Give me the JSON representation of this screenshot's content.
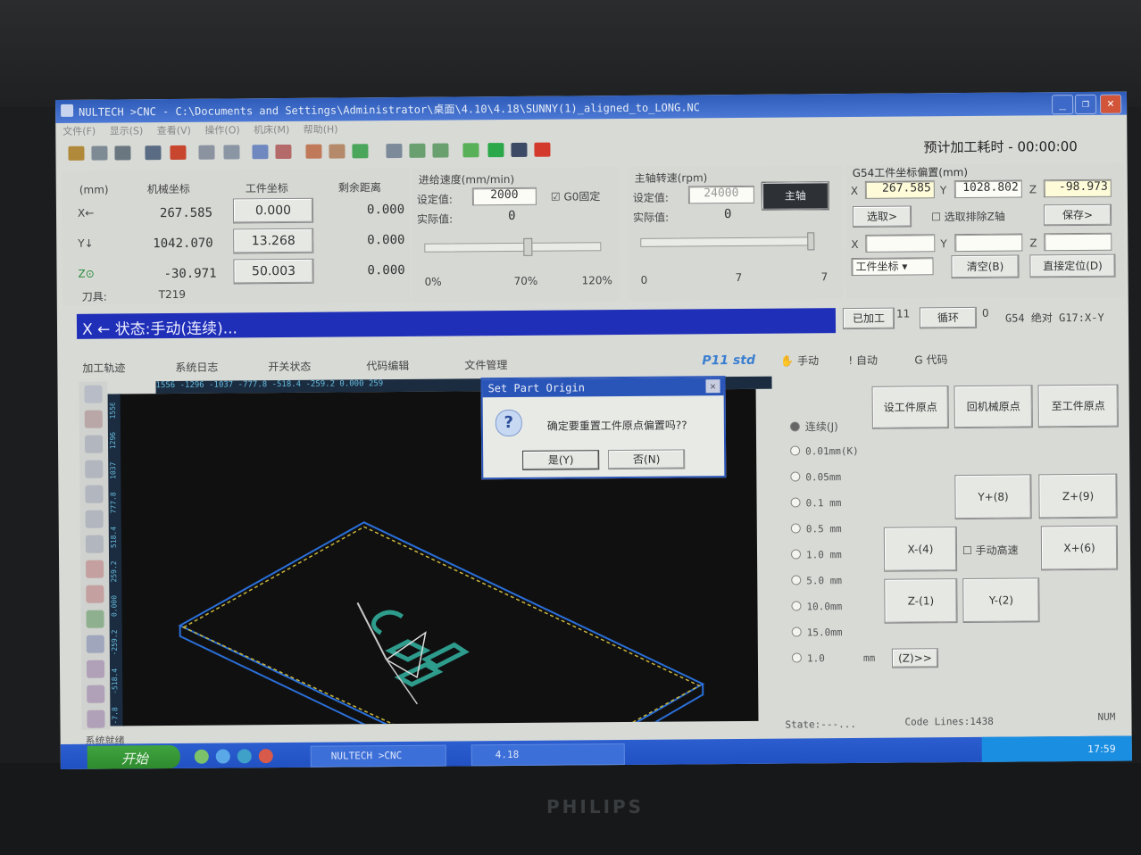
{
  "window": {
    "title": "NULTECH >CNC  - C:\\Documents and Settings\\Administrator\\桌面\\4.10\\4.18\\SUNNY(1)_aligned_to_LONG.NC",
    "buttons": {
      "minimize": "_",
      "restore": "❐",
      "close": "✕"
    }
  },
  "menu": [
    "文件(F)",
    "显示(S)",
    "查看(V)",
    "操作(O)",
    "机床(M)",
    "帮助(H)"
  ],
  "estimate": {
    "label": "预计加工耗时",
    "value": "- 00:00:00"
  },
  "coords": {
    "unit": "(mm)",
    "headers": [
      "机械坐标",
      "工件坐标",
      "剩余距离"
    ],
    "rows": [
      {
        "axis": "X←",
        "machine": "267.585",
        "work": "0.000",
        "remain": "0.000"
      },
      {
        "axis": "Y↓",
        "machine": "1042.070",
        "work": "13.268",
        "remain": "0.000"
      },
      {
        "axis": "Z⊙",
        "machine": "-30.971",
        "work": "50.003",
        "remain": "0.000"
      }
    ],
    "tool_label": "刀具:",
    "tool_value": "T219"
  },
  "feed": {
    "title": "进给速度(mm/min)",
    "set_label": "设定值:",
    "set_value": "2000",
    "g0_label": "G0固定",
    "actual_label": "实际值:",
    "actual_value": "0",
    "scale": [
      "0%",
      "70%",
      "120%"
    ]
  },
  "spindle": {
    "title": "主轴转速(rpm)",
    "set_label": "设定值:",
    "set_value": "24000",
    "actual_label": "实际值:",
    "actual_value": "0",
    "button": "主轴",
    "scale": [
      "0",
      "7",
      "7"
    ]
  },
  "g54": {
    "title": "G54工件坐标偏置(mm)",
    "x": "267.585",
    "y": "1028.802",
    "z": "-98.973",
    "select_button": "选取>",
    "exclude_z": "选取排除Z轴",
    "save_button": "保存>",
    "coord_select": "工件坐标",
    "clear_button": "清空(B)",
    "locate_button": "直接定位(D)",
    "axis_labels": [
      "X",
      "Y",
      "Z"
    ]
  },
  "status": {
    "text": "X ← 状态:手动(连续)...",
    "processed_label": "已加工",
    "processed_value": "11",
    "loop_label": "循环",
    "loop_value": "0",
    "mode": "G54 绝对 G17:X-Y"
  },
  "tabs": [
    "加工轨迹",
    "系统日志",
    "开关状态",
    "代码编辑",
    "文件管理"
  ],
  "p11": "P11 std",
  "ruler_top": "1556  -1296  -1037  -777.8  -518.4  -259.2  0.000  259",
  "ruler_left": [
    "1556",
    "1296",
    "1037",
    "777.8",
    "518.4",
    "259.2",
    "0.000",
    "-259.2",
    "-518.4",
    "-7.8"
  ],
  "dialog": {
    "title": "Set Part Origin",
    "message": "确定要重置工件原点偏置吗??",
    "yes": "是(Y)",
    "no": "否(N)"
  },
  "mode_tabs": [
    "手动",
    "自动",
    "G 代码"
  ],
  "jog": {
    "continuous": "连续(J)",
    "steps": [
      "0.01mm(K)",
      "0.05mm",
      "0.1 mm",
      "0.5 mm",
      "1.0 mm",
      "5.0 mm",
      "10.0mm",
      "15.0mm",
      "1.0"
    ],
    "custom_unit": "mm",
    "custom_button": "(Z)>>",
    "set_origin": "设工件原点",
    "home": "回机械原点",
    "to_origin": "至工件原点",
    "yplus": "Y+(8)",
    "zplus": "Z+(9)",
    "xminus": "X-(4)",
    "highspeed": "手动高速",
    "xplus": "X+(6)",
    "zminus": "Z-(1)",
    "yminus": "Y-(2)"
  },
  "bottom": {
    "left": "系统就绪",
    "state": "State:---...",
    "lines": "Code Lines:1438",
    "num": "NUM"
  },
  "taskbar": {
    "start": "开始",
    "task1": "NULTECH >CNC",
    "task2": "4.18",
    "clock": "17:59"
  },
  "brand": "PHILIPS"
}
